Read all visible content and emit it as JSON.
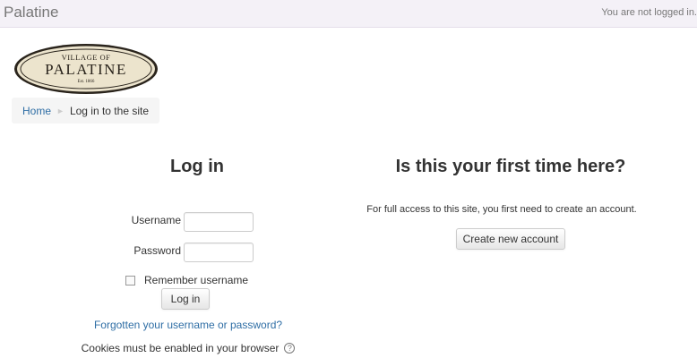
{
  "navbar": {
    "brand": "Palatine",
    "login_status": "You are not logged in."
  },
  "logo": {
    "line1": "VILLAGE OF",
    "line2": "PALATINE",
    "line3": "Est. 1866"
  },
  "breadcrumb": {
    "home": "Home",
    "separator": "►",
    "current": "Log in to the site"
  },
  "login": {
    "heading": "Log in",
    "username_label": "Username",
    "username_value": "",
    "password_label": "Password",
    "password_value": "",
    "remember_label": "Remember username",
    "login_button": "Log in",
    "forgot_link": "Forgotten your username or password?",
    "cookies_text": "Cookies must be enabled in your browser",
    "help_glyph": "?"
  },
  "signup": {
    "heading": "Is this your first time here?",
    "text": "For full access to this site, you first need to create an account.",
    "create_button": "Create new account"
  }
}
